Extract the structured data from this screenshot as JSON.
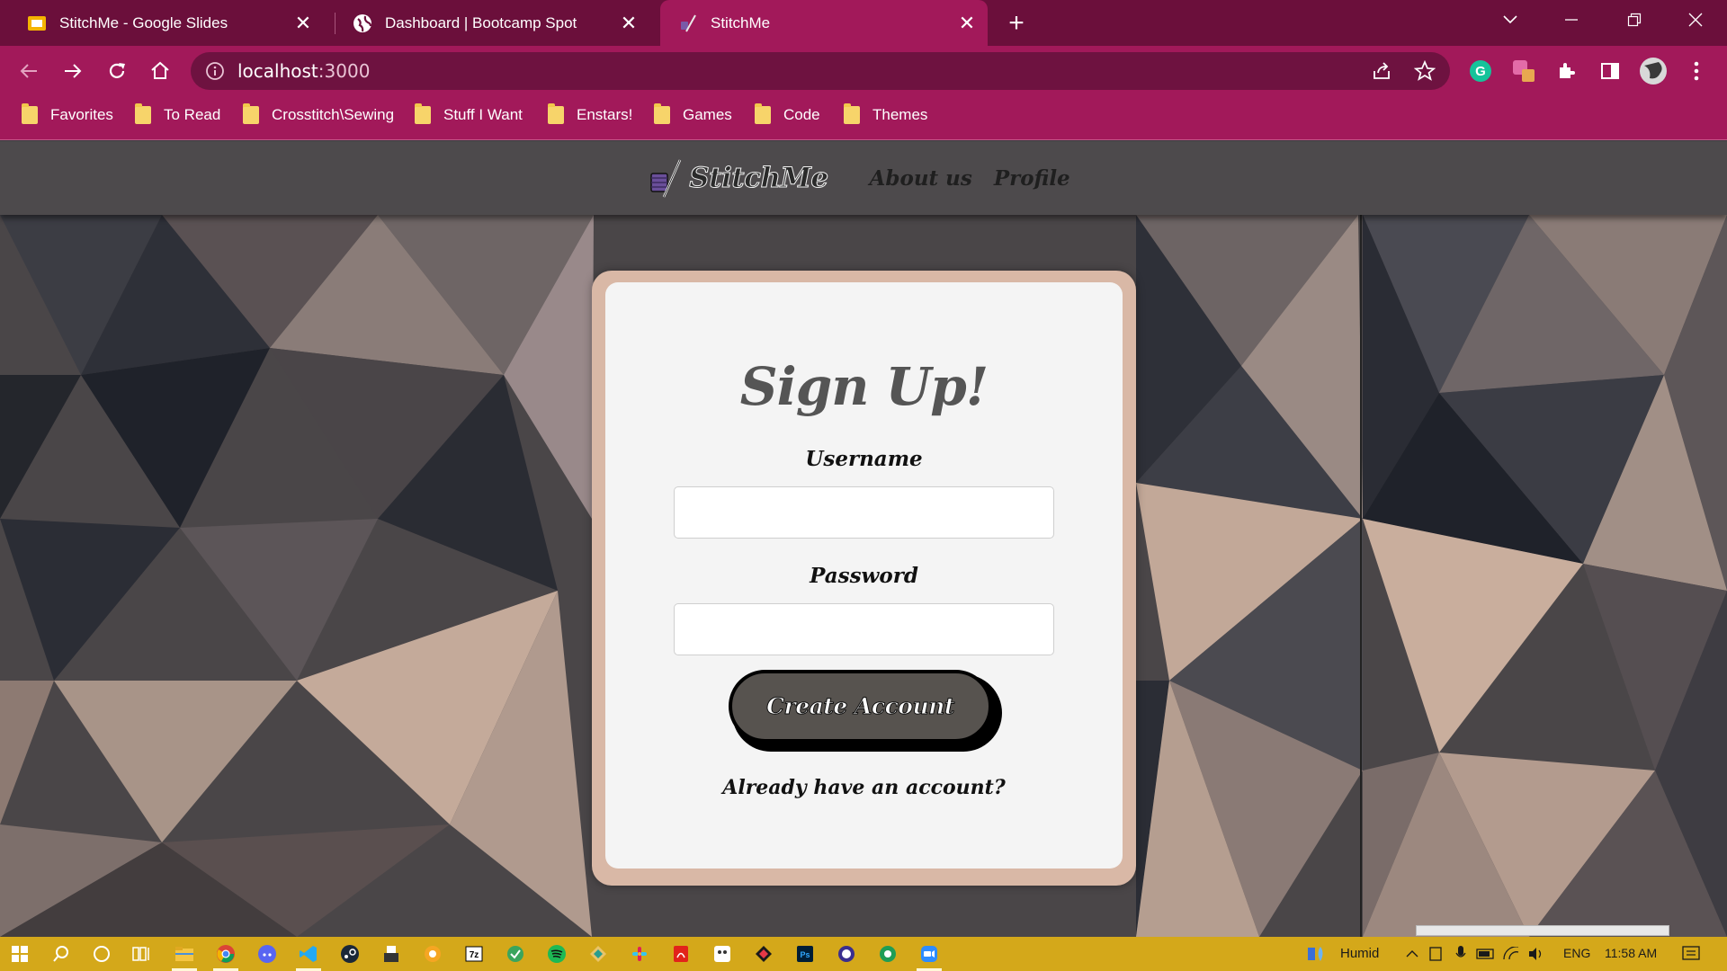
{
  "browser": {
    "tabs": [
      {
        "title": "StitchMe - Google Slides",
        "icon": "google-slides-icon"
      },
      {
        "title": "Dashboard | Bootcamp Spot",
        "icon": "globe-icon"
      },
      {
        "title": "StitchMe",
        "icon": "stitchme-favicon",
        "active": true
      }
    ],
    "url_host": "localhost",
    "url_port": ":3000",
    "bookmarks": [
      "Favorites",
      "To Read",
      "Crosstitch\\Sewing",
      "Stuff I Want",
      "Enstars!",
      "Games",
      "Code",
      "Themes"
    ]
  },
  "site": {
    "brand": "StitchMe",
    "nav": [
      "About us",
      "Profile"
    ]
  },
  "signup": {
    "heading": "Sign Up!",
    "username_label": "Username",
    "username_value": "",
    "password_label": "Password",
    "password_value": "",
    "submit_label": "Create Account",
    "login_prompt": "Already have an account?"
  },
  "taskbar": {
    "weather": "Humid",
    "language": "ENG",
    "time": "11:58 AM"
  },
  "colors": {
    "tabstrip": "#6b0f3b",
    "toolbar": "#a2195a",
    "site_nav": "#4d4a4c",
    "card_border": "#d9b8a6",
    "button": "#57534f",
    "taskbar": "#d4a81a"
  }
}
